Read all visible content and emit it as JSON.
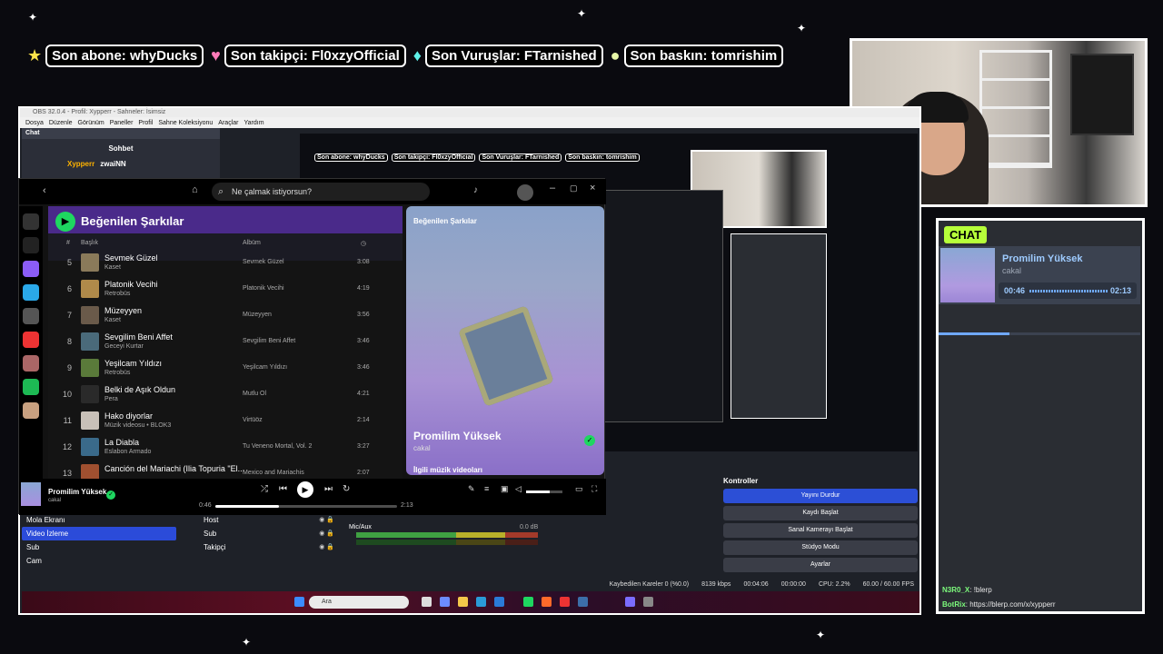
{
  "ticker": [
    {
      "icon": "★",
      "label": "Son abone: whyDucks"
    },
    {
      "icon": "♥",
      "label": "Son takipçi: Fl0xzyOfficial"
    },
    {
      "icon": "♦",
      "label": "Son Vuruşlar: FTarnished"
    },
    {
      "icon": "●",
      "label": "Son baskın: tomrishim"
    }
  ],
  "chat_panel": {
    "header": "CHAT",
    "now_playing": {
      "title": "Promilim Yüksek",
      "artist": "cakal",
      "elapsed": "00:46",
      "total": "02:13",
      "progress": 0.35
    },
    "messages": [
      {
        "user": "N3R0_X",
        "text": ": !blerp"
      },
      {
        "user": "BotRix",
        "text": ": https://blerp.com/x/xypperr"
      }
    ]
  },
  "obs": {
    "title": "OBS 32.0.4 - Profil: Xypperr - Sahneler: İsimsiz",
    "menu": [
      "Dosya",
      "Düzenle",
      "Görünüm",
      "Paneller",
      "Profil",
      "Sahne Koleksiyonu",
      "Araçlar",
      "Yardım"
    ],
    "chat_dock": {
      "title": "Chat",
      "section": "Sohbet",
      "user": "Xypperr",
      "viewer": "zwaiNN"
    },
    "preview_ticker": [
      "Son abone: whyDucks",
      "Son takipçi: Fl0xzyOfficial",
      "Son Vuruşlar: FTarnished",
      "Son baskın: tomrishim"
    ],
    "scenes": [
      "Mola Ekranı",
      "Video İzleme",
      "Sub",
      "Cam"
    ],
    "scene_selected": 1,
    "sources": [
      "Host",
      "Sub",
      "Takipçi"
    ],
    "mixer": {
      "name": "Mic/Aux",
      "db": "0.0 dB"
    },
    "controls": {
      "title": "Kontroller",
      "buttons": [
        "Yayını Durdur",
        "Kaydı Başlat",
        "Sanal Kamerayı Başlat",
        "Stüdyo Modu",
        "Ayarlar"
      ]
    },
    "status": {
      "dropped": "Kaybedilen Kareler 0 (%0.0)",
      "bitrate": "8139 kbps",
      "live": "00:04:06",
      "rec": "00:00:00",
      "cpu": "CPU: 2.2%",
      "fps": "60.00 / 60.00 FPS"
    },
    "taskbar_search": "Ara"
  },
  "spotify": {
    "search_placeholder": "Ne çalmak istiyorsun?",
    "playlist": "Beğenilen Şarkılar",
    "headers": {
      "num": "#",
      "title": "Başlık",
      "album": "Albüm"
    },
    "tracks": [
      {
        "n": "5",
        "title": "Sevmek Güzel",
        "artist": "Kaset",
        "album": "Sevmek Güzel",
        "dur": "3:08",
        "color": "#8a7a5a"
      },
      {
        "n": "6",
        "title": "Platonik Vecihi",
        "artist": "Retrobüs",
        "album": "Platonik Vecihi",
        "dur": "4:19",
        "color": "#b08a4a"
      },
      {
        "n": "7",
        "title": "Müzeyyen",
        "artist": "Kaset",
        "album": "Müzeyyen",
        "dur": "3:56",
        "color": "#6a5a4a"
      },
      {
        "n": "8",
        "title": "Sevgilim Beni Affet",
        "artist": "Geceyi Kurtar",
        "album": "Sevgilim Beni Affet",
        "dur": "3:46",
        "color": "#4a6a7a"
      },
      {
        "n": "9",
        "title": "Yeşilcam Yıldızı",
        "artist": "Retrobüs",
        "album": "Yeşilcam Yıldızı",
        "dur": "3:46",
        "color": "#5a7a3a"
      },
      {
        "n": "10",
        "title": "Belki de Aşık Oldun",
        "artist": "Pera",
        "album": "Mutlu Ol",
        "dur": "4:21",
        "color": "#2a2a2a"
      },
      {
        "n": "11",
        "title": "Hako diyorlar",
        "artist": "Müzik videosu • BLOK3",
        "album": "Virtüöz",
        "dur": "2:14",
        "color": "#c8c0b8"
      },
      {
        "n": "12",
        "title": "La Diabla",
        "artist": "Eslabon Armado",
        "album": "Tu Veneno Mortal, Vol. 2",
        "dur": "3:27",
        "color": "#3a6a8a"
      },
      {
        "n": "13",
        "title": "Canción del Mariachi (Ilia Topuria \"El...",
        "artist": "",
        "album": "Mexico and Mariachis",
        "dur": "2:07",
        "color": "#a05030"
      }
    ],
    "right_panel": {
      "header": "Beğenilen Şarkılar",
      "title": "Promilim Yüksek",
      "artist": "cakal",
      "section": "İlgili müzik videoları"
    },
    "player": {
      "title": "Promilim Yüksek",
      "artist": "cakal",
      "elapsed": "0:46",
      "total": "2:13",
      "progress": 0.35,
      "volume": 0.65
    }
  }
}
